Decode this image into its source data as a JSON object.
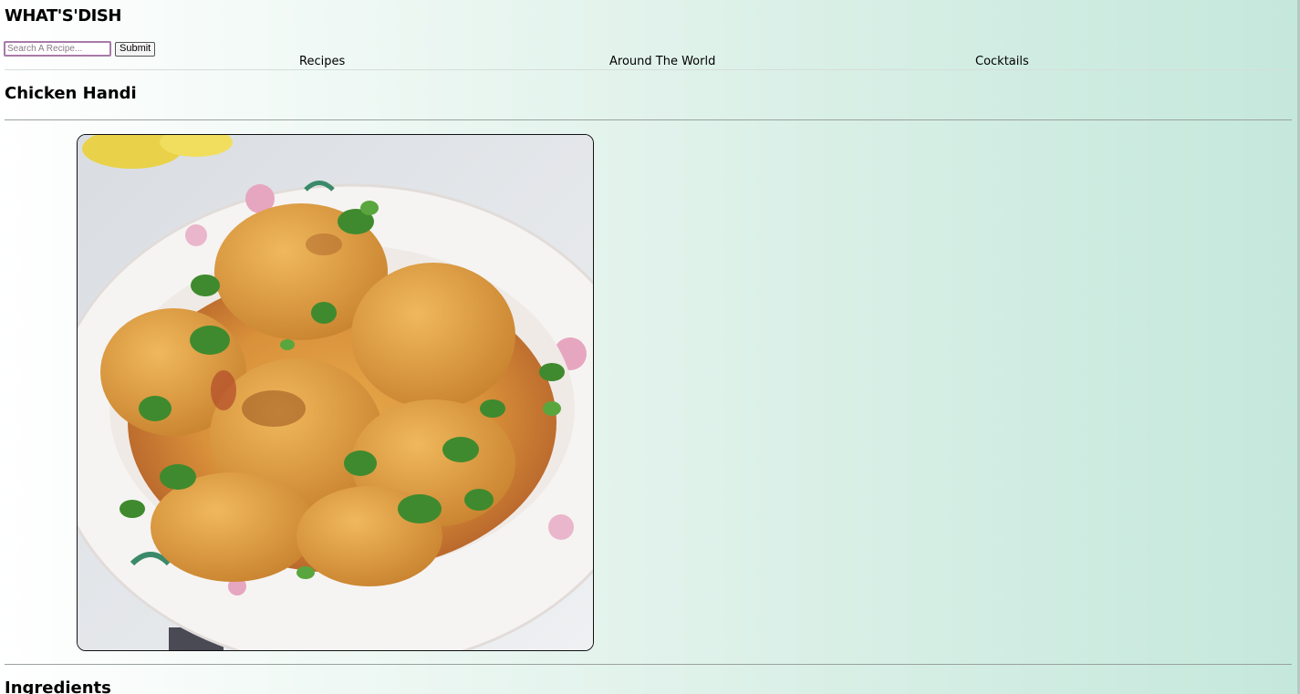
{
  "header": {
    "logo": "WHAT'S'DISH"
  },
  "search": {
    "placeholder": "Search A Recipe...",
    "value": "",
    "submit_label": "Submit"
  },
  "nav": {
    "items": [
      {
        "label": "Recipes"
      },
      {
        "label": "Around The World"
      },
      {
        "label": "Cocktails"
      }
    ]
  },
  "recipe": {
    "title": "Chicken Handi",
    "image_subject": "chicken-curry-in-floral-bowl",
    "ingredients_heading": "Ingredients"
  },
  "colors": {
    "background_start": "#ffffff",
    "background_end": "#c5e8dc",
    "input_border": "#a87aa8"
  }
}
